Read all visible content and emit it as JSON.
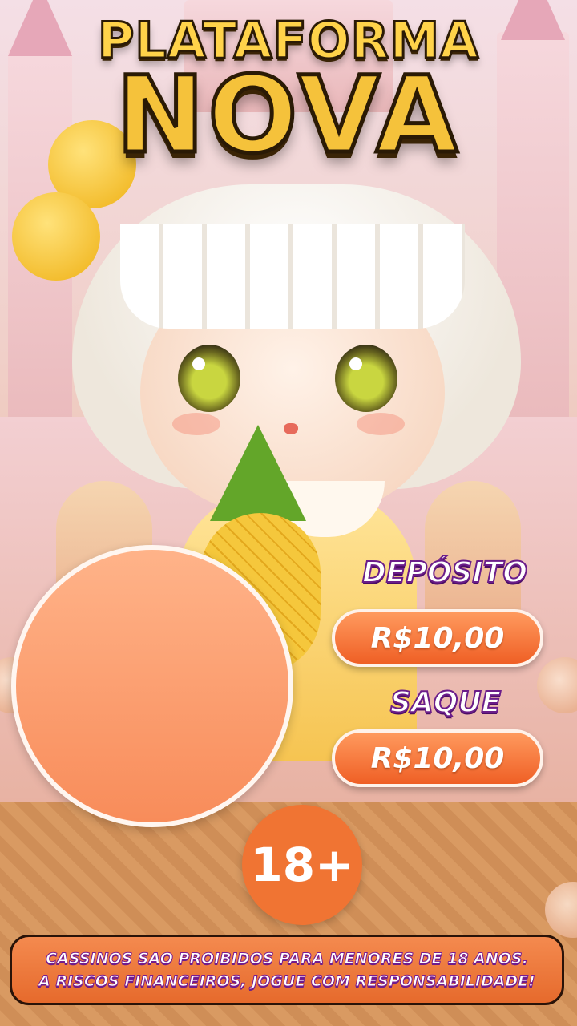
{
  "banner": {
    "title_line1": "PLATAFORMA",
    "title_line2": "NOVA"
  },
  "info": {
    "deposit_label": "DEPÓSITO",
    "deposit_value": "R$10,00",
    "withdraw_label": "SAQUE",
    "withdraw_value": "R$10,00"
  },
  "age_badge": "18+",
  "disclaimer": {
    "line1": "CASSINOS SAO PROIBIDOS PARA MENORES DE 18 ANOS.",
    "line2": "A RISCOS FINANCEIROS, JOGUE COM RESPONSABILIDADE!"
  },
  "colors": {
    "accent_orange": "#f07433",
    "label_purple": "#6b1d8a",
    "title_gold": "#f5c23b"
  }
}
